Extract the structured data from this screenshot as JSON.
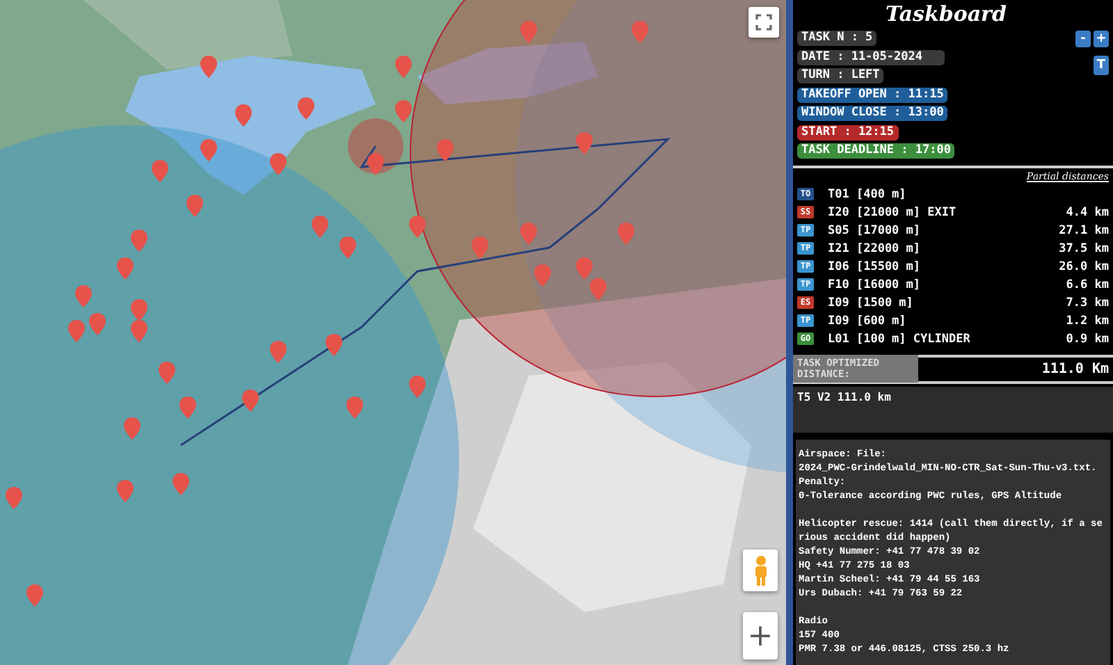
{
  "map": {
    "zoom_in": "+"
  },
  "taskboard": {
    "title": "Taskboard",
    "task_buttons": [
      "-",
      "+"
    ],
    "turn_button": "T",
    "fields": [
      {
        "text": "TASK N : 5",
        "color": "#3a3a3a"
      },
      {
        "text": "DATE : 11-05-2024",
        "color": "#3a3a3a"
      },
      {
        "text": "TURN : LEFT",
        "color": "#3a3a3a"
      },
      {
        "text": "TAKEOFF OPEN : 11:15",
        "color": "#1f5e9a"
      },
      {
        "text": "WINDOW CLOSE : 13:00",
        "color": "#1f5e9a"
      },
      {
        "text": "START : 12:15",
        "color": "#b52a2a"
      },
      {
        "text": "TASK DEADLINE : 17:00",
        "color": "#3d8f3d"
      }
    ],
    "distances_heading": "Partial distances",
    "turnpoints": [
      {
        "type": "TO",
        "color": "#24508a",
        "name": "T01 [400 m]"
      },
      {
        "type": "SS",
        "color": "#c0392b",
        "name": "I20 [21000 m] EXIT",
        "distance": "4.4 km"
      },
      {
        "type": "TP",
        "color": "#3a95d0",
        "name": "S05 [17000 m]",
        "distance": "27.1 km"
      },
      {
        "type": "TP",
        "color": "#3a95d0",
        "name": "I21 [22000 m]",
        "distance": "37.5 km"
      },
      {
        "type": "TP",
        "color": "#3a95d0",
        "name": "I06 [15500 m]",
        "distance": "26.0 km"
      },
      {
        "type": "TP",
        "color": "#3a95d0",
        "name": "F10 [16000 m]",
        "distance": "6.6 km"
      },
      {
        "type": "ES",
        "color": "#c0392b",
        "name": "I09 [1500 m]",
        "distance": "7.3 km"
      },
      {
        "type": "TP",
        "color": "#3a95d0",
        "name": "I09 [600 m]",
        "distance": "1.2 km"
      },
      {
        "type": "GO",
        "color": "#3a8f3a",
        "name": "L01 [100 m] CYLINDER",
        "distance": "0.9 km"
      }
    ],
    "total": {
      "label": "TASK OPTIMIZED DISTANCE:",
      "value": "111.0 Km"
    },
    "task_name": "T5 V2 111.0 km",
    "notes": [
      [
        "Airspace: File:",
        "2024_PWC-Grindelwald_MIN-NO-CTR_Sat-Sun-Thu-v3.txt.",
        "Penalty:",
        "0-Tolerance according PWC rules, GPS Altitude"
      ],
      [
        "Helicopter rescue: 1414 (call them directly, if a serious accident did happen)",
        "Safety Nummer: +41 77 478 39 02",
        "HQ +41 77 275 18 03",
        "Martin Scheel: +41 79 44 55 163",
        "Urs Dubach: +41 79 763 59 22"
      ],
      [
        "Radio",
        "157 400",
        "PMR 7.38 or 446.08125, CTSS 250.3 hz"
      ]
    ]
  }
}
